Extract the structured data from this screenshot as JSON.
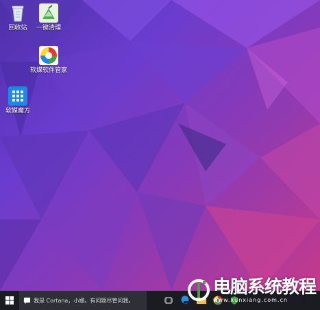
{
  "desktop": {
    "icons": [
      {
        "name": "recycle-bin",
        "label": "回收站"
      },
      {
        "name": "one-click-clean",
        "label": "一键清理"
      },
      {
        "name": "software-manager",
        "label": "软媒软件管家"
      },
      {
        "name": "rubik-cube",
        "label": "软媒魔方"
      }
    ]
  },
  "taskbar": {
    "search_placeholder": "我是 Cortana，小娜。有问题尽管问我。",
    "pinned": [
      "task-view",
      "edge",
      "file-explorer",
      "chrome",
      "store"
    ]
  },
  "watermark": {
    "text": "电脑系统教程",
    "url": "www.xunxiang.com.cn"
  }
}
